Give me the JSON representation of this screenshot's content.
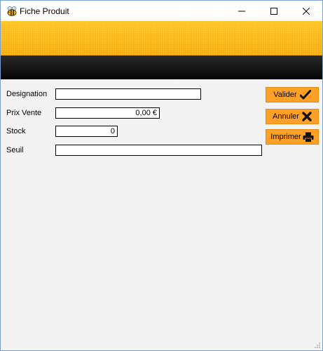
{
  "window": {
    "title": "Fiche Produit"
  },
  "form": {
    "designation_label": "Designation",
    "designation_value": "",
    "prix_label": "Prix Vente",
    "prix_value": "0,00 €",
    "stock_label": "Stock",
    "stock_value": "0",
    "seuil_label": "Seuil",
    "seuil_value": ""
  },
  "actions": {
    "valider_label": "Valider",
    "annuler_label": "Annuler",
    "imprimer_label": "Imprimer"
  },
  "icons": {
    "app": "bee-icon",
    "valider": "checkmark-icon",
    "annuler": "x-icon",
    "imprimer": "printer-icon"
  },
  "colors": {
    "banner_orange": "#ffc21a",
    "banner_black": "#0a0a0a",
    "button_orange": "#ffa126"
  }
}
